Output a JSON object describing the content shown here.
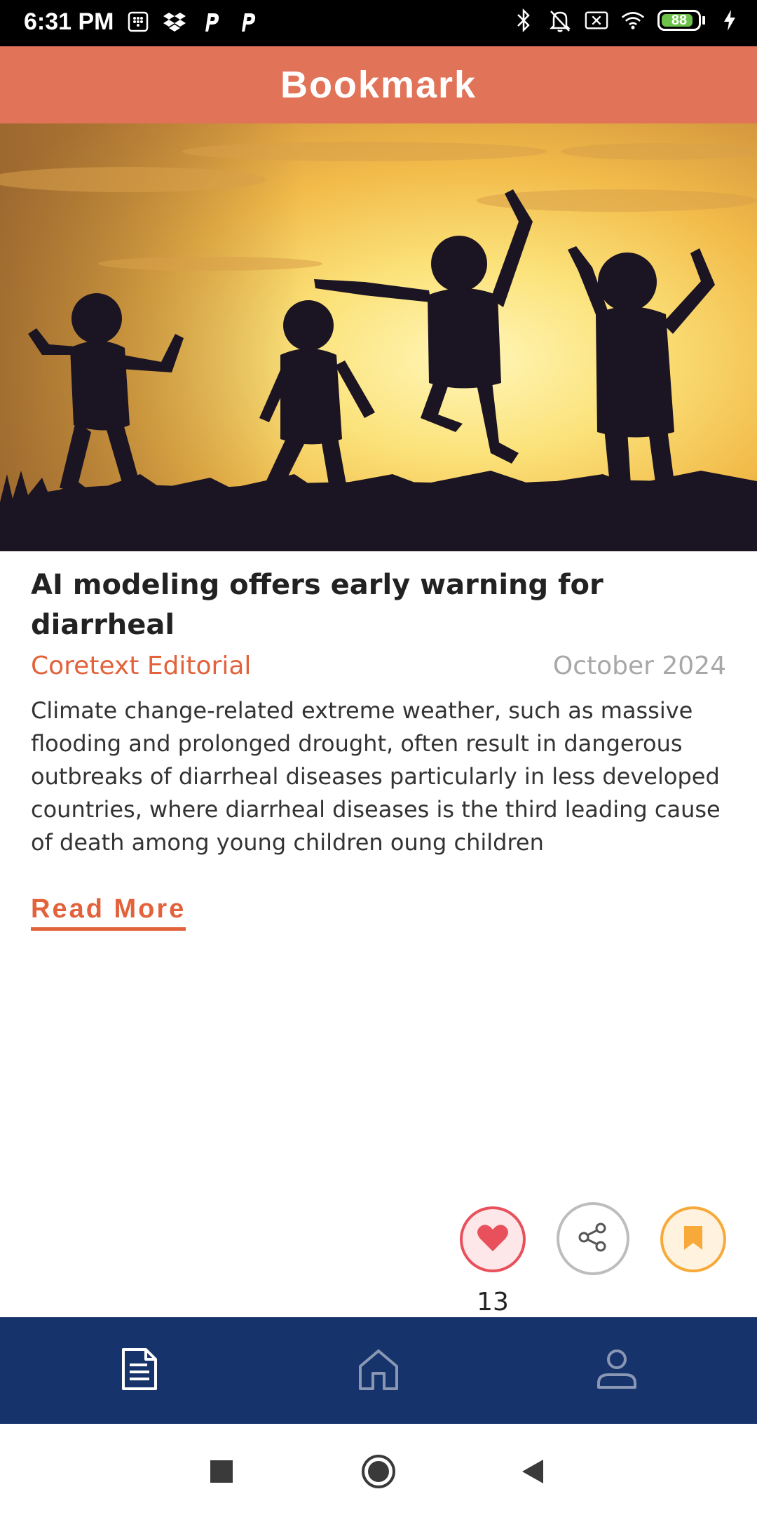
{
  "status_bar": {
    "time": "6:31 PM",
    "battery": "88",
    "battery_level": 0.88,
    "left_icons": [
      "keypad-icon",
      "dropbox-icon",
      "p-app-icon",
      "p-app-icon"
    ],
    "right_icons": [
      "bluetooth-icon",
      "bell-off-icon",
      "no-sim-icon",
      "wifi-icon",
      "battery-icon",
      "charging-icon"
    ]
  },
  "header": {
    "title": "Bookmark"
  },
  "article": {
    "image_description_icon": "hero-image",
    "title": "AI modeling offers early warning for diarrheal",
    "author": "Coretext Editorial",
    "date": "October 2024",
    "summary": "Climate change-related extreme weather, such as massive flooding and prolonged drought, often result in dangerous outbreaks of diarrheal diseases particularly in less developed countries, where diarrheal diseases is the third leading cause of death among young children oung children",
    "read_more": "Read More"
  },
  "actions": {
    "like_count": "13",
    "like_icon": "heart-icon",
    "share_icon": "share-icon",
    "bookmark_icon": "bookmark-icon"
  },
  "bottom_nav": {
    "items": [
      {
        "name": "articles",
        "icon": "document-icon",
        "active": true
      },
      {
        "name": "home",
        "icon": "home-icon",
        "active": false
      },
      {
        "name": "profile",
        "icon": "user-icon",
        "active": false
      }
    ]
  },
  "colors": {
    "header": "#e07358",
    "accent": "#e2623b",
    "nav_bg": "#17336b",
    "like": "#e8505b",
    "bookmark": "#f7a93a"
  }
}
